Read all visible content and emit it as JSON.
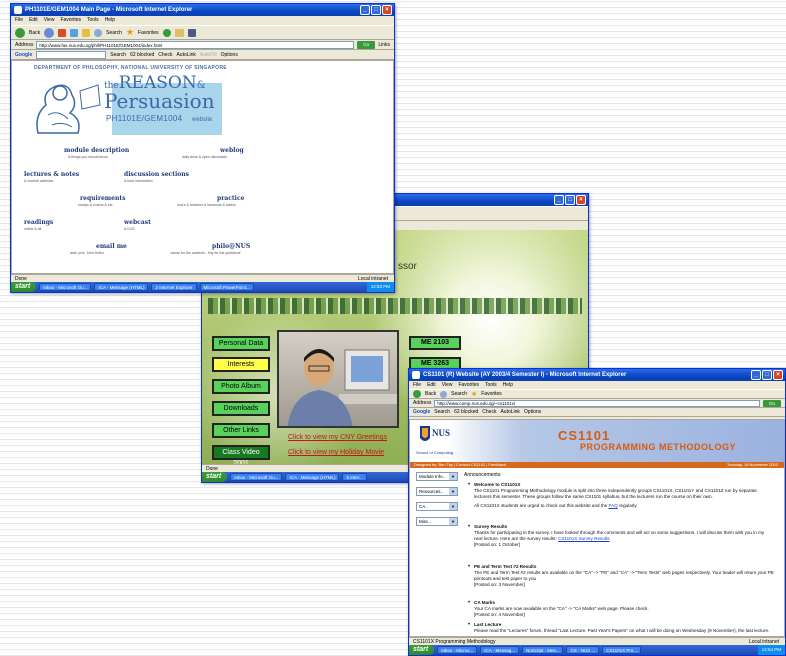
{
  "desktop": {
    "background": "#ffffff"
  },
  "common": {
    "menus": [
      "File",
      "Edit",
      "View",
      "Favorites",
      "Tools",
      "Help"
    ],
    "toolbar": {
      "back": "Back",
      "search": "Search",
      "favorites": "Favorites"
    },
    "address_label": "Address",
    "go": "Go",
    "links": "Links",
    "google": {
      "brand": "Google",
      "search": "Search",
      "blocked": "62 blocked",
      "check": "Check",
      "autolink": "AutoLink",
      "autofill": "AutoFill",
      "options": "Options"
    },
    "start": "start",
    "status_zone": "Local intranet"
  },
  "win_phil": {
    "title": "PH1101E/GEM1004 Main Page - Microsoft Internet Explorer",
    "address": "http://www.fas.nus.edu.sg/phil/PH1101E/GEM1004/index.html",
    "status_text": "Done",
    "department": "DEPARTMENT OF PHILOSOPHY, NATIONAL UNIVERSITY OF SINGAPORE",
    "title_the": "the",
    "title_reason": "REASON",
    "title_amp": "&",
    "title_persuasion": "Persuasion",
    "course": "PH1101E/GEM1004",
    "website": "website",
    "links": [
      {
        "label": "module description",
        "sub": "& things you should know"
      },
      {
        "label": "weblog",
        "sub": "daily dose & open discussion"
      },
      {
        "label": "lectures & notes",
        "sub": "& module calendar"
      },
      {
        "label": "discussion sections",
        "sub": "& tutor information"
      },
      {
        "label": "requirements",
        "sub": "essays & exams & etc."
      },
      {
        "label": "practice",
        "sub": "incy's & answers & handouts & advice"
      },
      {
        "label": "readings",
        "sub": "online & all"
      },
      {
        "label": "webcast",
        "sub": "& IVLE"
      },
      {
        "label": "email me",
        "sub": "asst. prof. John Holbo"
      },
      {
        "label": "philo@NUS",
        "sub": "'cause for the ancients - tiny for the questions'"
      }
    ],
    "taskbar": [
      "Inbox - Microsoft Ou...",
      "ICA - Message (HTML)",
      "2 Internet Explorer",
      "Microsoft PowerPoint..."
    ],
    "clock": "12:53 PM"
  },
  "win_personal": {
    "title_partial": "ssor",
    "nav": [
      "Personal Data",
      "Interests",
      "Photo Album",
      "Downloads",
      "Other Links",
      "Class Video 2001"
    ],
    "modules": [
      "ME 2103",
      "ME 3263"
    ],
    "greeting_link": "Click to view my CNY Greetings",
    "movie_link": "Click to view my Holiday Movie",
    "status_text": "Done",
    "taskbar": [
      "Inbox - Microsoft Ou...",
      "ICA - Message (HTML)",
      "6 Inter..."
    ]
  },
  "win_cs": {
    "title": "CS1101 (R) Website (AY 2003/4 Semester I) - Microsoft Internet Explorer",
    "address": "http://www.comp.nus.edu.sg/~cs1101x/",
    "school": "School of Computing",
    "module_code": "CS1101",
    "module_name": "PROGRAMMING METHODOLOGY",
    "nav_text": "Designed by: Ben Tay | Contact CS1101 | Feedback",
    "date": "Tuesday, 18 November 2003",
    "selects": [
      "Module Info..",
      "Resources..",
      "CA..",
      "Misc.."
    ],
    "announcements_label": "Announcements:",
    "items": [
      {
        "title": "Welcome to CS1101X",
        "body": "The CS1101 Programming Methodology module is split into three independently groups CS1101X, CS1101Y and CS1101Z run by separate lecturers this semester. These groups follow the same CS1101 syllabus, but the lecturers run the course on their own.",
        "note": "All CS1101X students are urged to check out this website and the ",
        "note_link": "FAQ",
        "note_tail": " regularly."
      },
      {
        "title": "Survey Results",
        "body": "Thanks for participating in the survey. I have looked through the comments and will act on some suggestions. I will discuss them with you in my next lecture. Here are the survey results: ",
        "link": "CS1101X Survey Results",
        "posted": "[Posted on: 1 October]"
      },
      {
        "title": "PE and Term Test #2 Results",
        "body": "The PE and Term Test #2 results are available on the \"CA\" -> \"PE\" and \"CA\" -> \"Term Tests\" web pages respectively. Your leader will return your PE printouts and test paper to you",
        "posted": "[Posted on: 3 November]"
      },
      {
        "title": "CA Marks",
        "body": "Your CA marks are now available on the \"CA\" -> \"CA Marks\" web page. Please check.",
        "posted": "[Posted on: 4 November]"
      },
      {
        "title": "Last Lecture",
        "body": "Please read the \"Lectures\" forum, thread \"Last Lecture. Past Year's Papers\" on what I will be doing on Wednesday (9 November), the last lecture."
      }
    ],
    "status_text": "CS1101X Programming Methodology",
    "taskbar": [
      "Inbox - Micros...",
      "ICA - Messag...",
      "NoScript - Mes...",
      "CS - NUS ...",
      "CS1101X Pro..."
    ],
    "clock": "12:54 PM"
  }
}
